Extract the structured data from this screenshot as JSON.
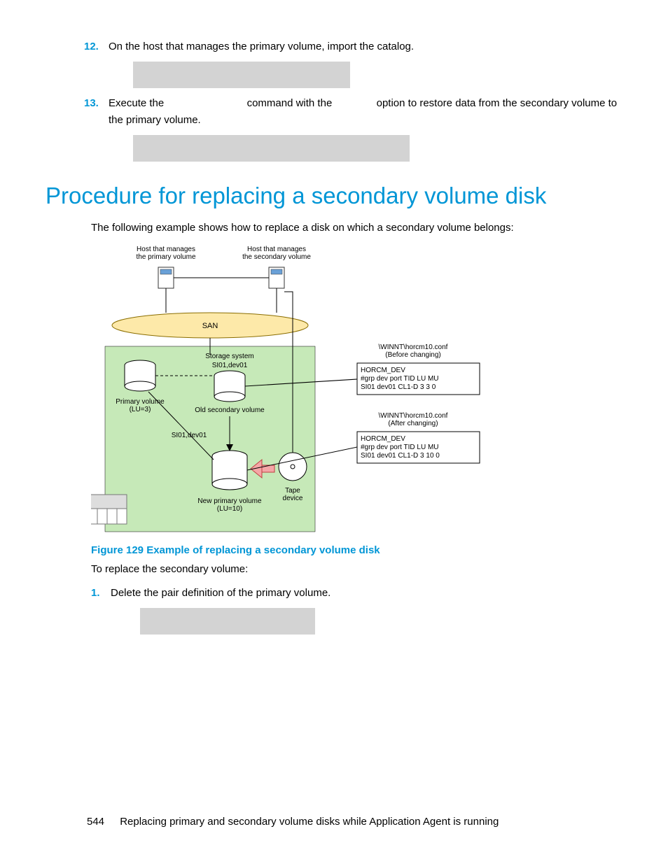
{
  "steps_top": [
    {
      "num": "12.",
      "text": "On the host that manages the primary volume, import the catalog."
    },
    {
      "num": "13.",
      "text_parts": [
        "Execute the ",
        " command with the ",
        " option to restore data from the secondary volume to the primary volume."
      ]
    }
  ],
  "section_heading": "Procedure for replacing a secondary volume disk",
  "intro": "The following example shows how to replace a disk on which a secondary volume belongs:",
  "figure": {
    "caption": "Figure 129 Example of replacing a secondary volume disk",
    "labels": {
      "host_primary": "Host  that manages\nthe primary volume",
      "host_secondary": "Host that manages\nthe secondary volume",
      "san": "SAN",
      "storage_system": "Storage system",
      "si01a": "SI01,dev01",
      "si01b": "SI01,dev01",
      "primary_volume": "Primary volume\n(LU=3)",
      "old_secondary": "Old secondary volume",
      "new_primary": "New primary volume\n(LU=10)",
      "tape": "Tape\ndevice",
      "conf_before_title": "\\WINNT\\horcm10.conf\n(Before changing)",
      "conf_after_title": "\\WINNT\\horcm10.conf\n(After changing)",
      "conf_header": "HORCM_DEV",
      "conf_cols": "#grp  dev  port          TID LU  MU",
      "conf_before_row": "SI01 dev01 CL1-D   3    3    0",
      "conf_after_row": "SI01 dev01 CL1-D   3   10   0"
    }
  },
  "replace_intro": "To replace the secondary volume:",
  "substeps": [
    {
      "num": "1.",
      "text": "Delete the pair definition of the primary volume."
    }
  ],
  "footer": {
    "page": "544",
    "title": "Replacing primary and secondary volume disks while Application Agent is running"
  }
}
